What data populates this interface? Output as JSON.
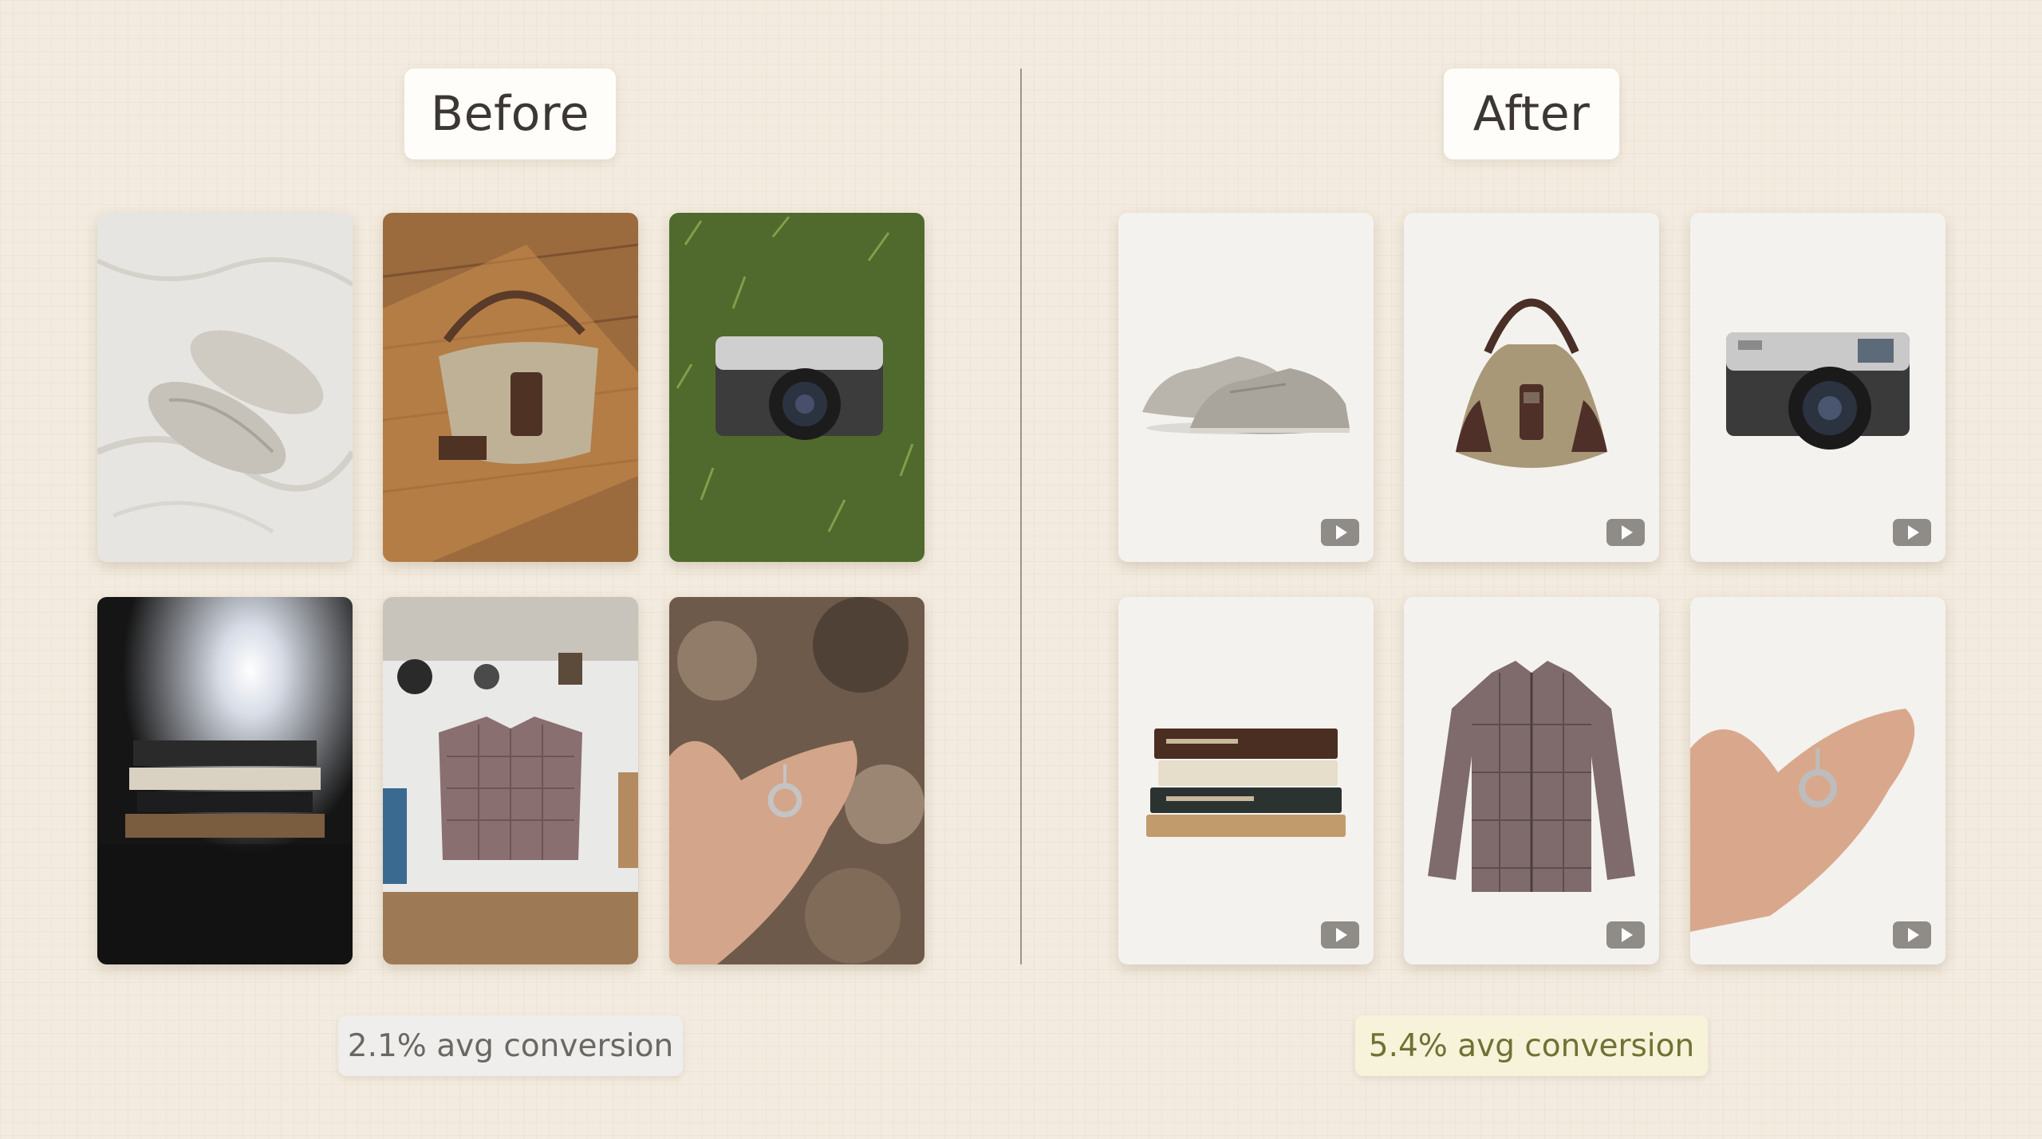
{
  "before": {
    "title": "Before",
    "conversion": "2.1% avg conversion",
    "products": [
      {
        "icon": "sneakers-photo"
      },
      {
        "icon": "handbag-photo"
      },
      {
        "icon": "camera-photo"
      },
      {
        "icon": "books-photo"
      },
      {
        "icon": "shirt-photo"
      },
      {
        "icon": "pendant-photo"
      }
    ]
  },
  "after": {
    "title": "After",
    "conversion": "5.4% avg conversion",
    "play_icon": "play-icon",
    "products": [
      {
        "icon": "sneakers-photo"
      },
      {
        "icon": "handbag-photo"
      },
      {
        "icon": "camera-photo"
      },
      {
        "icon": "books-photo"
      },
      {
        "icon": "shirt-photo"
      },
      {
        "icon": "pendant-photo"
      }
    ]
  },
  "colors": {
    "background": "#f3ebdf",
    "before_stat_text": "#6b6864",
    "after_stat_text": "#6f7233",
    "after_stat_bg": "#f7f3da"
  }
}
